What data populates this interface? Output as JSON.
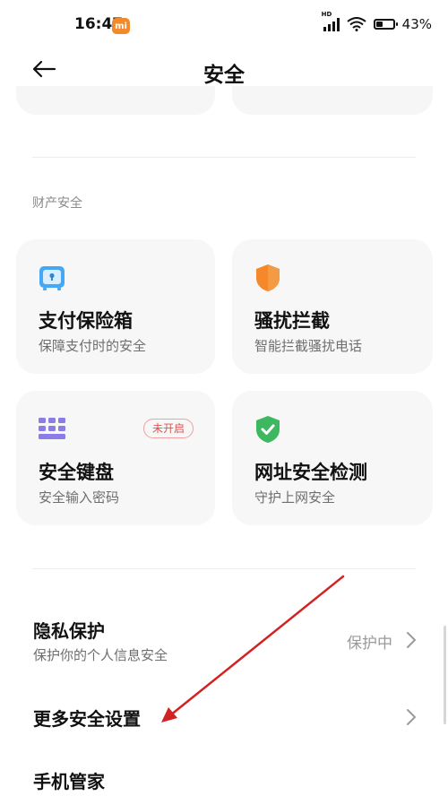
{
  "status_bar": {
    "time": "16:47",
    "app_badge": "mi",
    "network_label": "HD",
    "battery": "43%",
    "battery_level": 0.43,
    "icons": [
      "signal-icon",
      "wifi-icon",
      "battery-icon"
    ]
  },
  "header": {
    "title": "安全",
    "back_icon": "arrow-left-icon"
  },
  "section": {
    "label": "财产安全"
  },
  "cards": [
    {
      "title": "支付保险箱",
      "subtitle": "保障支付时的安全",
      "icon": "safe-box-icon",
      "color": "#42a5f5"
    },
    {
      "title": "骚扰拦截",
      "subtitle": "智能拦截骚扰电话",
      "icon": "orange-shield-icon",
      "color": "#f5892a"
    },
    {
      "title": "安全键盘",
      "subtitle": "安全输入密码",
      "icon": "keyboard-grid-icon",
      "color": "#8a7de6",
      "badge": "未开启"
    },
    {
      "title": "网址安全检测",
      "subtitle": "守护上网安全",
      "icon": "green-shield-check-icon",
      "color": "#3db860"
    }
  ],
  "rows": [
    {
      "title": "隐私保护",
      "subtitle": "保护你的个人信息安全",
      "value": "保护中"
    },
    {
      "title": "更多安全设置"
    },
    {
      "title": "手机管家"
    }
  ],
  "colors": {
    "badge_red": "#e0524e",
    "annotation_arrow": "#d32222",
    "card_bg": "#f7f7f7"
  }
}
